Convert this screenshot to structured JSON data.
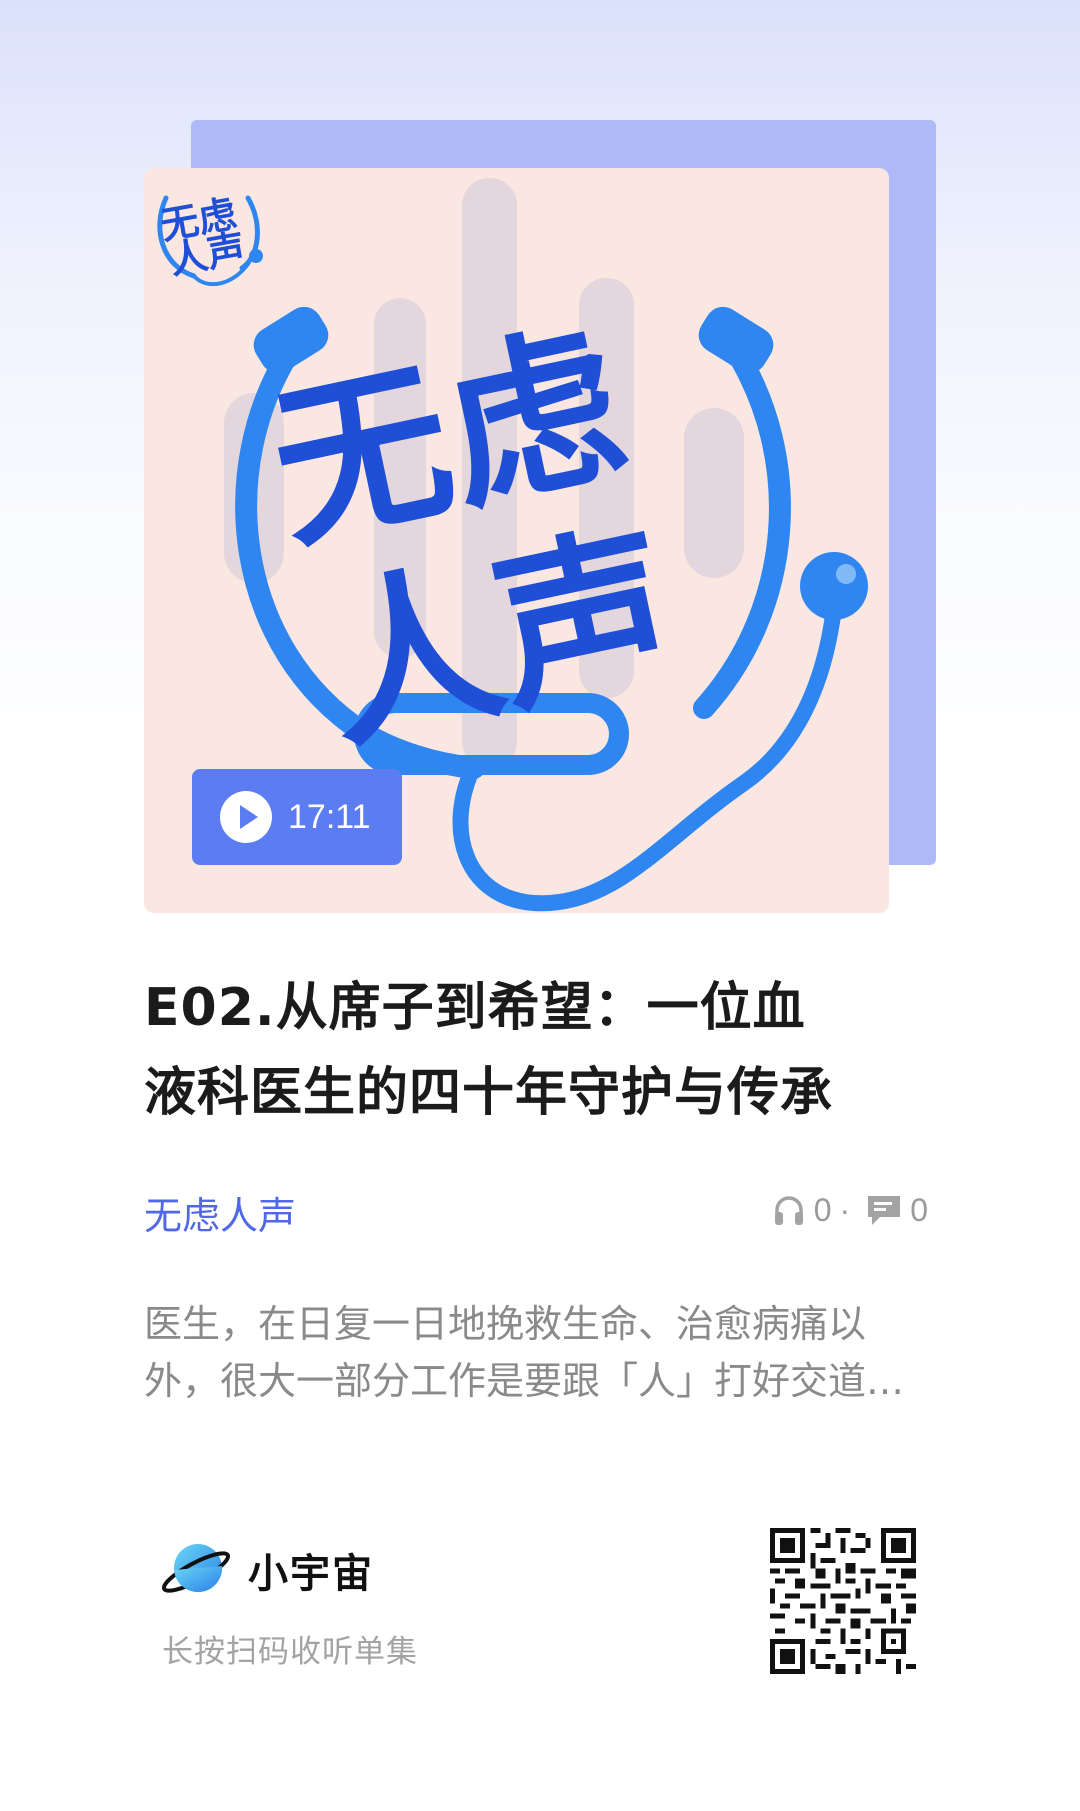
{
  "cover": {
    "logo_text": [
      "无虑",
      "人声"
    ],
    "duration": "17:11",
    "colors": {
      "accent": "#5c7cf2",
      "cover_bg": "#fbe7e2",
      "logo_blue": "#1f4fd6",
      "stethoscope_blue": "#2f86f0"
    }
  },
  "episode": {
    "title_lines": [
      "E02.从席子到希望：一位血",
      "液科医生的四十年守护与传承"
    ]
  },
  "podcast": {
    "name": "无虑人声"
  },
  "stats": {
    "listens": "0",
    "separator": "·",
    "comments": "0"
  },
  "description": {
    "lines": [
      "医生，在日复一日地挽救生命、治愈病痛以",
      "外，很大一部分工作是要跟「人」打好交道…"
    ]
  },
  "footer": {
    "brand": "小宇宙",
    "hint": "长按扫码收听单集"
  }
}
